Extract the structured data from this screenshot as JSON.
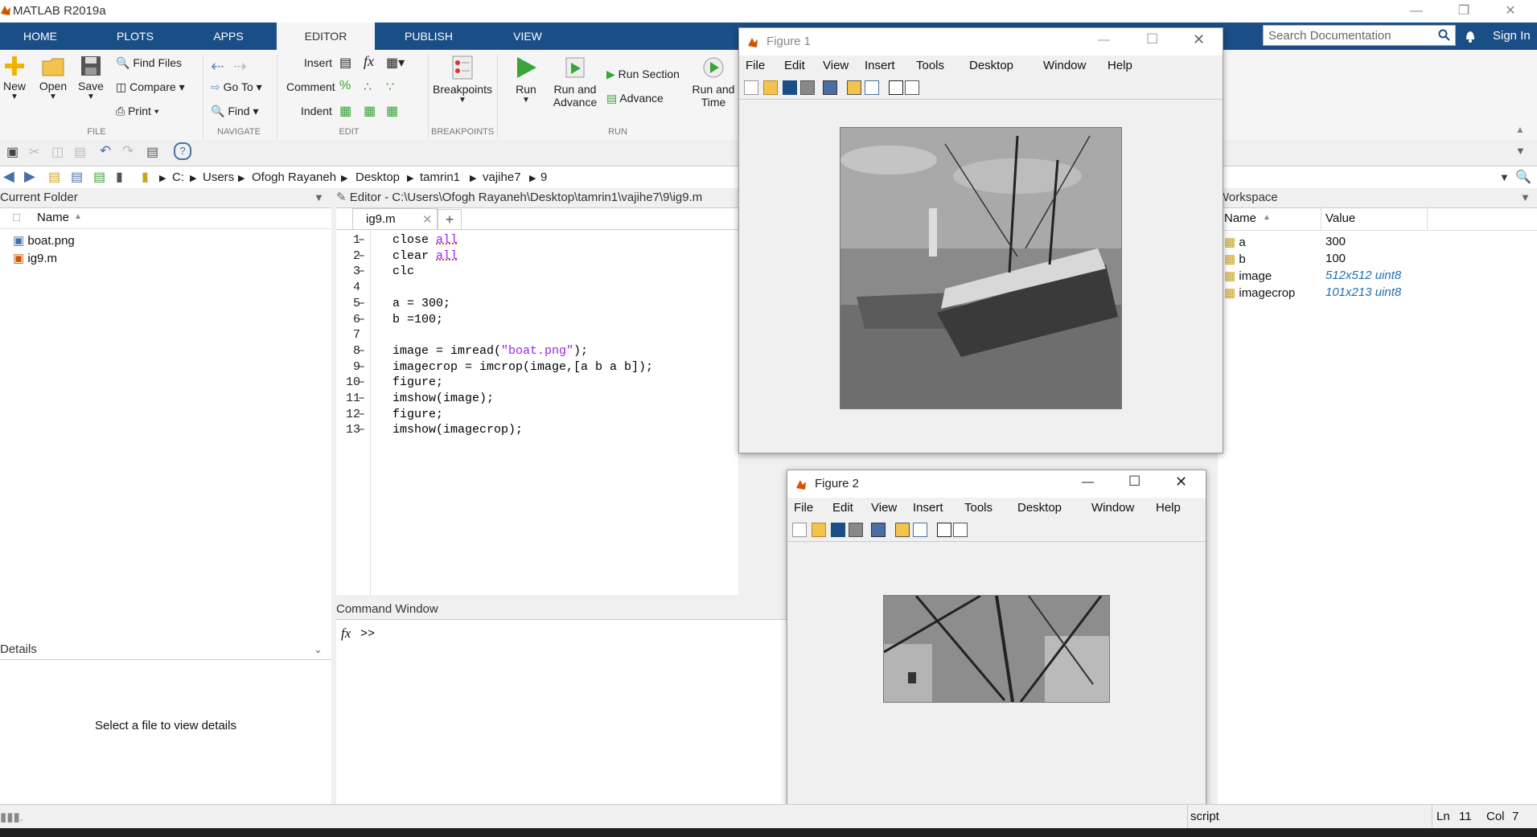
{
  "app": {
    "title": "MATLAB R2019a",
    "sign_in": "Sign In",
    "search_placeholder": "Search Documentation"
  },
  "tabs": [
    {
      "label": "HOME"
    },
    {
      "label": "PLOTS"
    },
    {
      "label": "APPS"
    },
    {
      "label": "EDITOR"
    },
    {
      "label": "PUBLISH"
    },
    {
      "label": "VIEW"
    }
  ],
  "ribbon": {
    "new": "New",
    "open": "Open",
    "save": "Save",
    "find_files": "Find Files",
    "compare": "Compare",
    "print": "Print",
    "goto": "Go To",
    "find": "Find",
    "insert": "Insert",
    "comment": "Comment",
    "indent": "Indent",
    "breakpoints": "Breakpoints",
    "run": "Run",
    "run_and_advance": "Run and Advance",
    "run_section": "Run Section",
    "advance": "Advance",
    "run_and_time": "Run and Time",
    "groups": {
      "file": "FILE",
      "navigate": "NAVIGATE",
      "edit": "EDIT",
      "breakpoints": "BREAKPOINTS",
      "run": "RUN"
    }
  },
  "path": [
    "C:",
    "Users",
    "Ofogh Rayaneh",
    "Desktop",
    "tamrin1",
    "vajihe7",
    "9"
  ],
  "current_folder": {
    "title": "Current Folder",
    "column": "Name",
    "files": [
      {
        "name": "boat.png"
      },
      {
        "name": "ig9.m"
      }
    ]
  },
  "details": {
    "title": "Details",
    "message": "Select a file to view details"
  },
  "editor": {
    "title": "Editor - C:\\Users\\Ofogh Rayaneh\\Desktop\\tamrin1\\vajihe7\\9\\ig9.m",
    "tab": "ig9.m",
    "lines": [
      "close all",
      "clear all",
      "clc",
      "",
      "a = 300;",
      "b =100;",
      "",
      "image = imread(\"boat.png\");",
      "imagecrop = imcrop(image,[a b a b]);",
      "figure;",
      "imshow(image);",
      "figure;",
      "imshow(imagecrop);"
    ]
  },
  "command_window": {
    "title": "Command Window",
    "prompt": ">>",
    "fx": "fx"
  },
  "workspace": {
    "title": "Workspace",
    "columns": [
      "Name",
      "Value"
    ],
    "vars": [
      {
        "name": "a",
        "value": "300"
      },
      {
        "name": "b",
        "value": "100"
      },
      {
        "name": "image",
        "value": "512x512 uint8"
      },
      {
        "name": "imagecrop",
        "value": "101x213 uint8"
      }
    ]
  },
  "figures": {
    "menu": [
      "File",
      "Edit",
      "View",
      "Insert",
      "Tools",
      "Desktop",
      "Window",
      "Help"
    ],
    "fig1_title": "Figure 1",
    "fig2_title": "Figure 2"
  },
  "status": {
    "mode": "script",
    "ln_label": "Ln",
    "ln": "11",
    "col_label": "Col",
    "col": "7"
  },
  "colors": {
    "tab_bar": "#1a4e86",
    "run_green": "#3aa33a",
    "keyword": "#a020f0"
  }
}
